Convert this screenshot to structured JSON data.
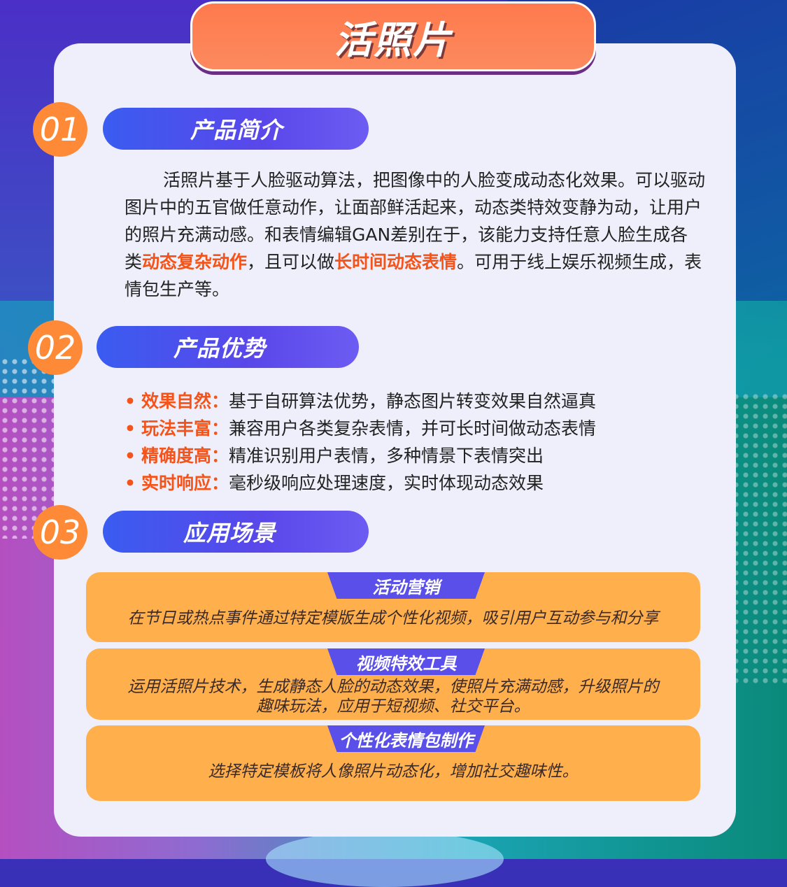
{
  "title": "活照片",
  "sections": [
    {
      "num": "01",
      "label": "产品简介"
    },
    {
      "num": "02",
      "label": "产品优势"
    },
    {
      "num": "03",
      "label": "应用场景"
    }
  ],
  "intro": {
    "p1": "活照片基于人脸驱动算法，把图像中的人脸变成动态化效果。可以驱动图片中的五官做任意动作，让面部鲜活起来，动态类特效变静为动，让用户的照片充满动感。和表情编辑GAN差别在于，该能力支持任意人脸生成各类",
    "hl1": "动态复杂动作",
    "p2": "，且可以做",
    "hl2": "长时间动态表情",
    "p3": "。可用于线上娱乐视频生成，表情包生产等。"
  },
  "advantages": [
    {
      "label": "效果自然：",
      "text": "基于自研算法优势，静态图片转变效果自然逼真"
    },
    {
      "label": "玩法丰富：",
      "text": "兼容用户各类复杂表情，并可长时间做动态表情"
    },
    {
      "label": "精确度高：",
      "text": "精准识别用户表情，多种情景下表情突出"
    },
    {
      "label": "实时响应：",
      "text": "毫秒级响应处理速度，实时体现动态效果"
    }
  ],
  "scenes": [
    {
      "tab": "活动营销",
      "desc": "在节日或热点事件通过特定模版生成个性化视频，吸引用户互动参与和分享"
    },
    {
      "tab": "视频特效工具",
      "desc1": "运用活照片技术，生成静态人脸的动态效果，使照片充满动感，升级照片的",
      "desc2": "趣味玩法，应用于短视频、社交平台。"
    },
    {
      "tab": "个性化表情包制作",
      "desc": "选择特定模板将人像照片动态化，增加社交趣味性。"
    }
  ],
  "bullet": "•"
}
